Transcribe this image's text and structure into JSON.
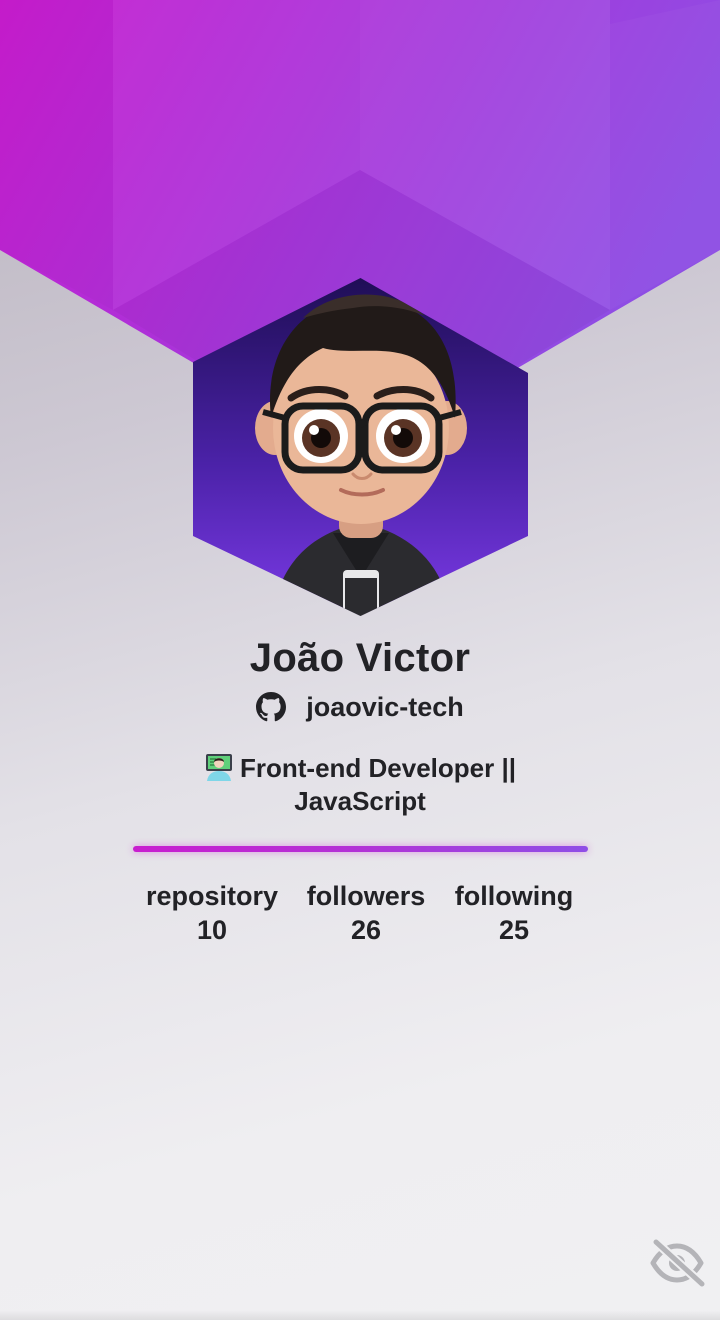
{
  "profile": {
    "name": "João Victor",
    "username": "joaovic-tech",
    "bio": "Front-end Developer || JavaScript",
    "bio_emoji": "technologist-emoji",
    "avatar_icon": "avatar-memoji"
  },
  "stats": [
    {
      "label": "repository",
      "value": "10"
    },
    {
      "label": "followers",
      "value": "26"
    },
    {
      "label": "following",
      "value": "25"
    }
  ],
  "icons": {
    "github": "github-icon",
    "visibility": "eye-off-icon"
  },
  "colors": {
    "accent_magenta": "#c81dcf",
    "accent_purple": "#8f4ee6",
    "avatar_bg_dark": "#1f0e56",
    "avatar_bg_light": "#7b3ae6",
    "text": "#222226",
    "icon_muted": "#b4b4b8"
  }
}
